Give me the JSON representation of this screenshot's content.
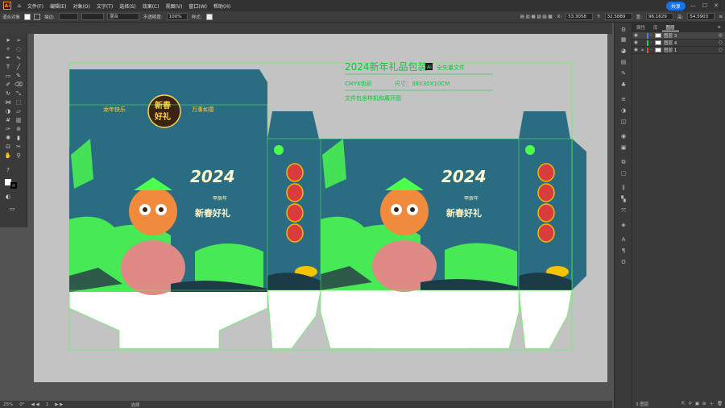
{
  "app": {
    "logo": "Ai"
  },
  "menu": [
    "文件(F)",
    "编辑(E)",
    "对象(O)",
    "文字(T)",
    "选择(S)",
    "效果(C)",
    "视图(V)",
    "窗口(W)",
    "帮助(H)"
  ],
  "share_label": "共享",
  "control": {
    "object_type": "混合对象",
    "stroke_label": "描边:",
    "blend_mode": "混合",
    "opacity_label": "不透明度:",
    "opacity": "100%",
    "style_label": "样式:",
    "x": "53.3058",
    "y": "32.5889",
    "w_label": "宽:",
    "w": "96.1629",
    "h_label": "高:",
    "h": "54.5903"
  },
  "panel": {
    "tabs": [
      "属性",
      "库",
      "图层"
    ],
    "active_tab": "图层",
    "layers": [
      {
        "name": "图层 3",
        "color": "#4f7bff",
        "locked": false,
        "selected": true
      },
      {
        "name": "图层 4",
        "color": "#2ecc40",
        "locked": false,
        "selected": false
      },
      {
        "name": "图层 1",
        "color": "#e74c3c",
        "locked": true,
        "selected": false
      }
    ],
    "footer_label": "3 图层"
  },
  "status": {
    "zoom": "25%",
    "rotation": "0°",
    "artboard": "1",
    "mode": "选择"
  },
  "artwork": {
    "title": "2024新年礼品包装",
    "ai_badge": "Ai",
    "vector_label": "全矢量文件",
    "color_mode": "CMYK色彩",
    "size": "尺寸：38X30X10CM",
    "note": "文件包含样机和展开图",
    "badge_line1": "新春",
    "badge_line2": "好礼",
    "left_slogan": "龙年快乐",
    "right_slogan": "万事如意",
    "year": "2024",
    "year_sub": "甲辰年",
    "greeting": "新春好礼"
  },
  "colors": {
    "accent": "#4cff4c",
    "teal": "#2a6d82",
    "artboard": "#c3c3c3"
  }
}
